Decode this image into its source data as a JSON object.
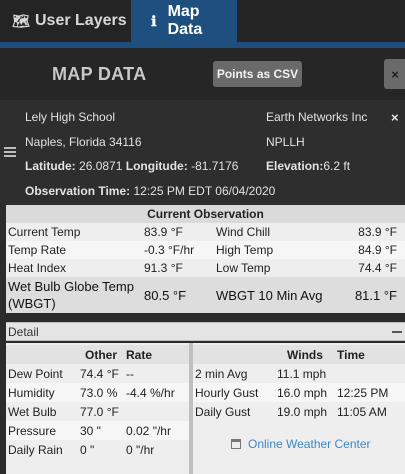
{
  "tabs": [
    {
      "label": "User Layers",
      "icon": "map-icon"
    },
    {
      "label": "Map Data",
      "icon": "info-icon"
    }
  ],
  "header": {
    "title": "MAP DATA",
    "csv_button": "Points as CSV",
    "close": "×"
  },
  "station": {
    "name": "Lely High School",
    "provider": "Earth Networks Inc",
    "city": "Naples, Florida 34116",
    "code": "NPLLH",
    "latitude_label": "Latitude:",
    "latitude": "26.0871",
    "longitude_label": "Longitude:",
    "longitude": "-81.7176",
    "elevation_label": "Elevation:",
    "elevation": "6.2 ft",
    "obs_time_label": "Observation Time:",
    "obs_time": "12:25 PM EDT 06/04/2020",
    "close": "×"
  },
  "current": {
    "title": "Current Observation",
    "rows": [
      [
        "Current Temp",
        "83.9 °F",
        "Wind Chill",
        "83.9 °F"
      ],
      [
        "Temp Rate",
        "-0.3 °F/hr",
        "High Temp",
        "84.9 °F"
      ],
      [
        "Heat Index",
        "91.3 °F",
        "Low Temp",
        "74.4 °F"
      ]
    ],
    "wbgt": [
      "Wet Bulb Globe Temp (WBGT)",
      "80.5 °F",
      "WBGT 10 Min Avg",
      "81.1 °F"
    ]
  },
  "detail_label": "Detail",
  "other": {
    "headers": [
      "",
      "Other",
      "Rate"
    ],
    "rows": [
      [
        "Dew Point",
        "74.4 °F",
        "--"
      ],
      [
        "Humidity",
        "73.0 %",
        "-4.4 %/hr"
      ],
      [
        "Wet Bulb",
        "77.0 °F",
        ""
      ],
      [
        "Pressure",
        "30 \"",
        "0.02 \"/hr"
      ],
      [
        "Daily Rain",
        "0 \"",
        "0 \"/hr"
      ]
    ]
  },
  "winds": {
    "headers": [
      "",
      "Winds",
      "Time"
    ],
    "rows": [
      [
        "2 min Avg",
        "11.1 mph",
        ""
      ],
      [
        "Hourly Gust",
        "16.0 mph",
        "12:25 PM"
      ],
      [
        "Daily Gust",
        "19.0 mph",
        "11:05 AM"
      ]
    ]
  },
  "link": "Online Weather Center"
}
